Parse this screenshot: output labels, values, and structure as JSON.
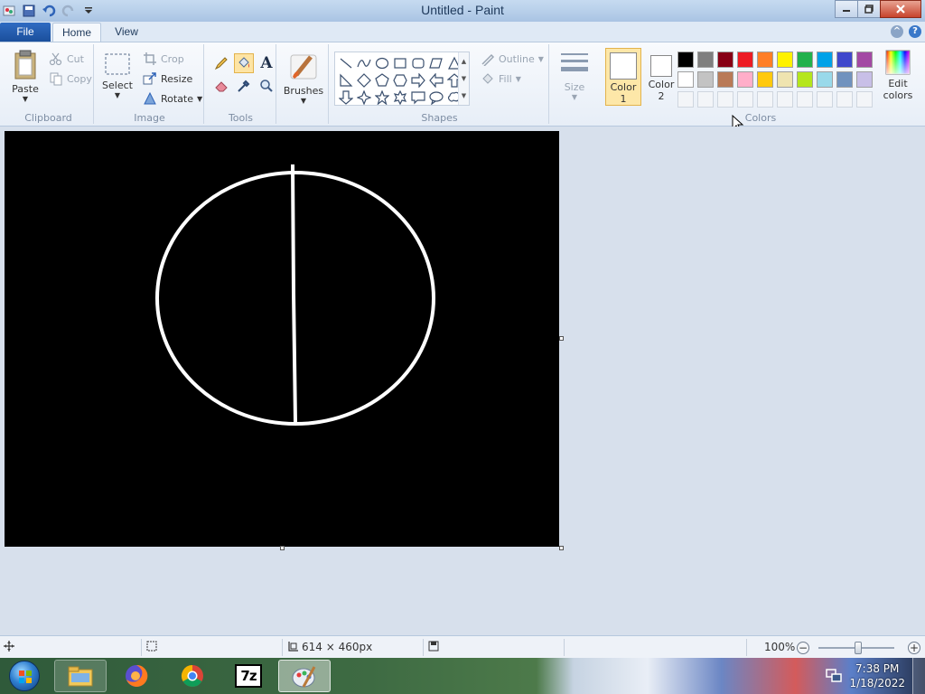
{
  "window": {
    "title": "Untitled - Paint"
  },
  "tabs": {
    "file": "File",
    "home": "Home",
    "view": "View"
  },
  "clipboard": {
    "paste": "Paste",
    "cut": "Cut",
    "copy": "Copy",
    "group_label": "Clipboard"
  },
  "image": {
    "select": "Select",
    "crop": "Crop",
    "resize": "Resize",
    "rotate": "Rotate",
    "group_label": "Image"
  },
  "tools": {
    "group_label": "Tools",
    "items": [
      "pencil-icon",
      "fill-bucket-icon",
      "text-icon",
      "eraser-icon",
      "color-picker-icon",
      "magnifier-icon"
    ],
    "active": "fill-bucket-icon"
  },
  "brushes": {
    "label": "Brushes"
  },
  "shapes": {
    "group_label": "Shapes",
    "outline": "Outline",
    "fill": "Fill"
  },
  "size": {
    "label": "Size"
  },
  "colors": {
    "group_label": "Colors",
    "color1_label_line1": "Color",
    "color1_label_line2": "1",
    "color2_label_line1": "Color",
    "color2_label_line2": "2",
    "color1_value": "#ffffff",
    "color2_value": "#ffffff",
    "edit_line1": "Edit",
    "edit_line2": "colors",
    "palette_row1": [
      "#000000",
      "#7f7f7f",
      "#880015",
      "#ed1c24",
      "#ff7f27",
      "#fff200",
      "#22b14c",
      "#00a2e8",
      "#3f48cc",
      "#a349a4"
    ],
    "palette_row2": [
      "#ffffff",
      "#c3c3c3",
      "#b97a57",
      "#ffaec9",
      "#ffc90e",
      "#efe4b0",
      "#b5e61d",
      "#99d9ea",
      "#7092be",
      "#c8bfe7"
    ]
  },
  "canvas": {
    "background": "#000000",
    "stroke": "#ffffff"
  },
  "status": {
    "dimensions": "614 × 460px",
    "zoom": "100%",
    "zoom_level_percent": 100
  },
  "taskbar": {
    "time": "7:38 PM",
    "date": "1/18/2022",
    "apps": [
      "file-explorer-icon",
      "firefox-icon",
      "chrome-icon",
      "7zip-icon",
      "paint-icon"
    ],
    "sevenzip_label": "7z"
  }
}
